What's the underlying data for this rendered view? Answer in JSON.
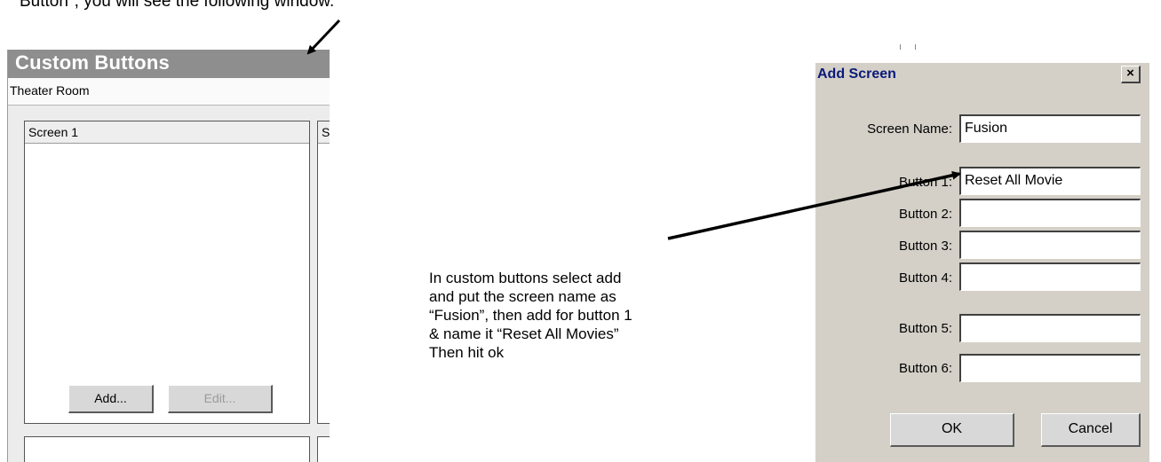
{
  "doc": {
    "top_text": "Button\", you will see the following window.",
    "instruction_lines": [
      "In custom buttons select add",
      "and put the screen name as",
      "“Fusion”, then add for button 1",
      "& name it “Reset All Movies”",
      "Then hit ok"
    ]
  },
  "custom_buttons": {
    "title": "Custom Buttons",
    "room": "Theater Room",
    "screen1_label": "Screen 1",
    "screen2_label": "S",
    "add_label": "Add...",
    "edit_label": "Edit..."
  },
  "dialog": {
    "title": "Add Screen",
    "close_glyph": "×",
    "screen_name_label": "Screen Name:",
    "screen_name_value": "Fusion",
    "buttons": [
      {
        "label": "Button 1:",
        "value": "Reset All Movie"
      },
      {
        "label": "Button 2:",
        "value": ""
      },
      {
        "label": "Button 3:",
        "value": ""
      },
      {
        "label": "Button 4:",
        "value": ""
      },
      {
        "label": "Button 5:",
        "value": ""
      },
      {
        "label": "Button 6:",
        "value": ""
      }
    ],
    "ok_label": "OK",
    "cancel_label": "Cancel"
  }
}
